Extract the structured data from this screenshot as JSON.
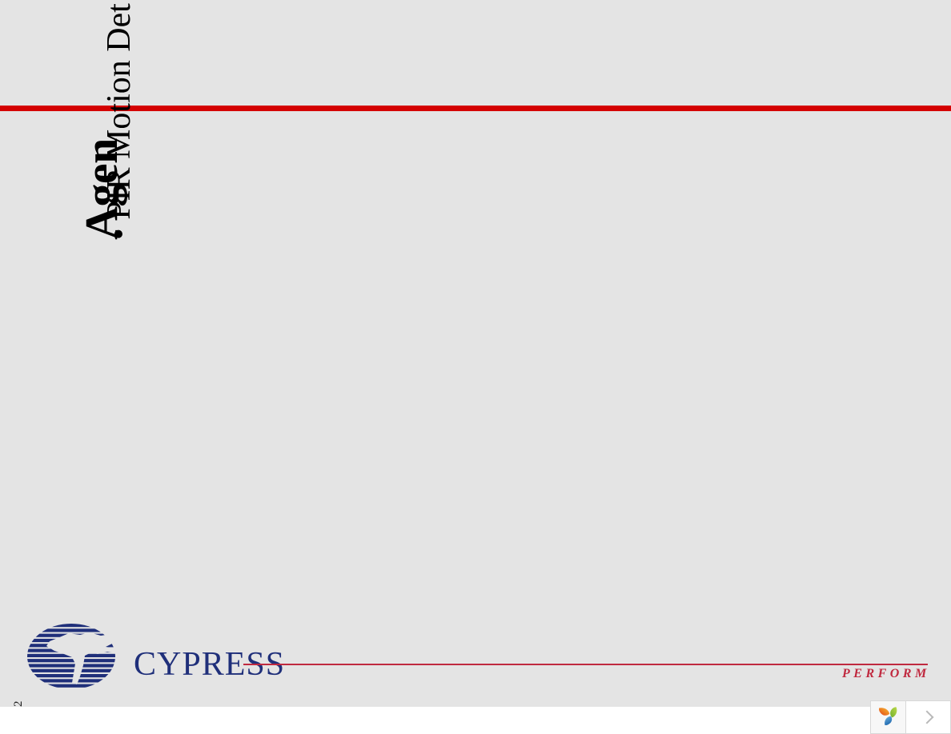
{
  "document": {
    "background_color": "#e4e4e4",
    "accent_red": "#d40000",
    "brand_blue": "#1f2f7a",
    "brand_red": "#c0293f",
    "page_number": "2",
    "corner_mark": "’"
  },
  "slide": {
    "title": "Agen",
    "bullets": [
      "• PIR Motion Det"
    ]
  },
  "footer": {
    "wordmark": "CYPRESS",
    "tagline": "PERFORM",
    "logo_icon": "cypress-globe-icon"
  },
  "toolbar": {
    "brand_icon": "pinwheel-leaf-logo-icon",
    "next_icon": "chevron-right-icon",
    "brand_colors": {
      "orange": "#ec7a2a",
      "red_orange": "#e04a24",
      "green": "#8cc63f",
      "yellow_green": "#b5d334",
      "blue": "#2f84c8",
      "light_blue": "#5ba7d9"
    }
  }
}
